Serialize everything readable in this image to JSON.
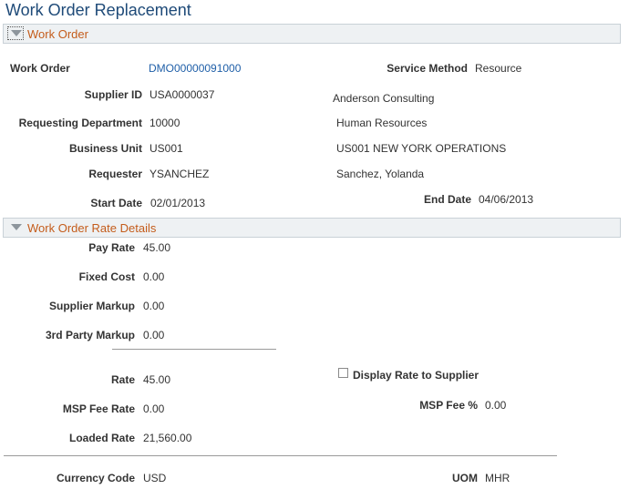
{
  "page": {
    "title": "Work Order  Replacement"
  },
  "work_order_section": {
    "header": "Work Order",
    "work_order_label": "Work Order",
    "work_order_value": "DMO00000091000",
    "service_method_label": "Service Method",
    "service_method_value": "Resource",
    "supplier_id_label": "Supplier ID",
    "supplier_id_value": "USA0000037",
    "supplier_name": "Anderson Consulting",
    "requesting_dept_label": "Requesting Department",
    "requesting_dept_value": "10000",
    "requesting_dept_name": "Human Resources",
    "business_unit_label": "Business Unit",
    "business_unit_value": "US001",
    "business_unit_name": "US001 NEW YORK OPERATIONS",
    "requester_label": "Requester",
    "requester_value": "YSANCHEZ",
    "requester_name": "Sanchez, Yolanda",
    "start_date_label": "Start Date",
    "start_date_value": "02/01/2013",
    "end_date_label": "End Date",
    "end_date_value": "04/06/2013"
  },
  "rate_section": {
    "header": "Work Order Rate Details",
    "pay_rate_label": "Pay Rate",
    "pay_rate_value": "45.00",
    "fixed_cost_label": "Fixed Cost",
    "fixed_cost_value": "0.00",
    "supplier_markup_label": "Supplier Markup",
    "supplier_markup_value": "0.00",
    "third_party_markup_label": "3rd Party Markup",
    "third_party_markup_value": "0.00",
    "rate_label": "Rate",
    "rate_value": "45.00",
    "display_rate_label": "Display Rate to Supplier",
    "display_rate_checked": false,
    "msp_fee_rate_label": "MSP Fee Rate",
    "msp_fee_rate_value": "0.00",
    "msp_fee_pct_label": "MSP Fee %",
    "msp_fee_pct_value": "0.00",
    "loaded_rate_label": "Loaded Rate",
    "loaded_rate_value": "21,560.00",
    "currency_code_label": "Currency Code",
    "currency_code_value": "USD",
    "uom_label": "UOM",
    "uom_value": "MHR"
  }
}
